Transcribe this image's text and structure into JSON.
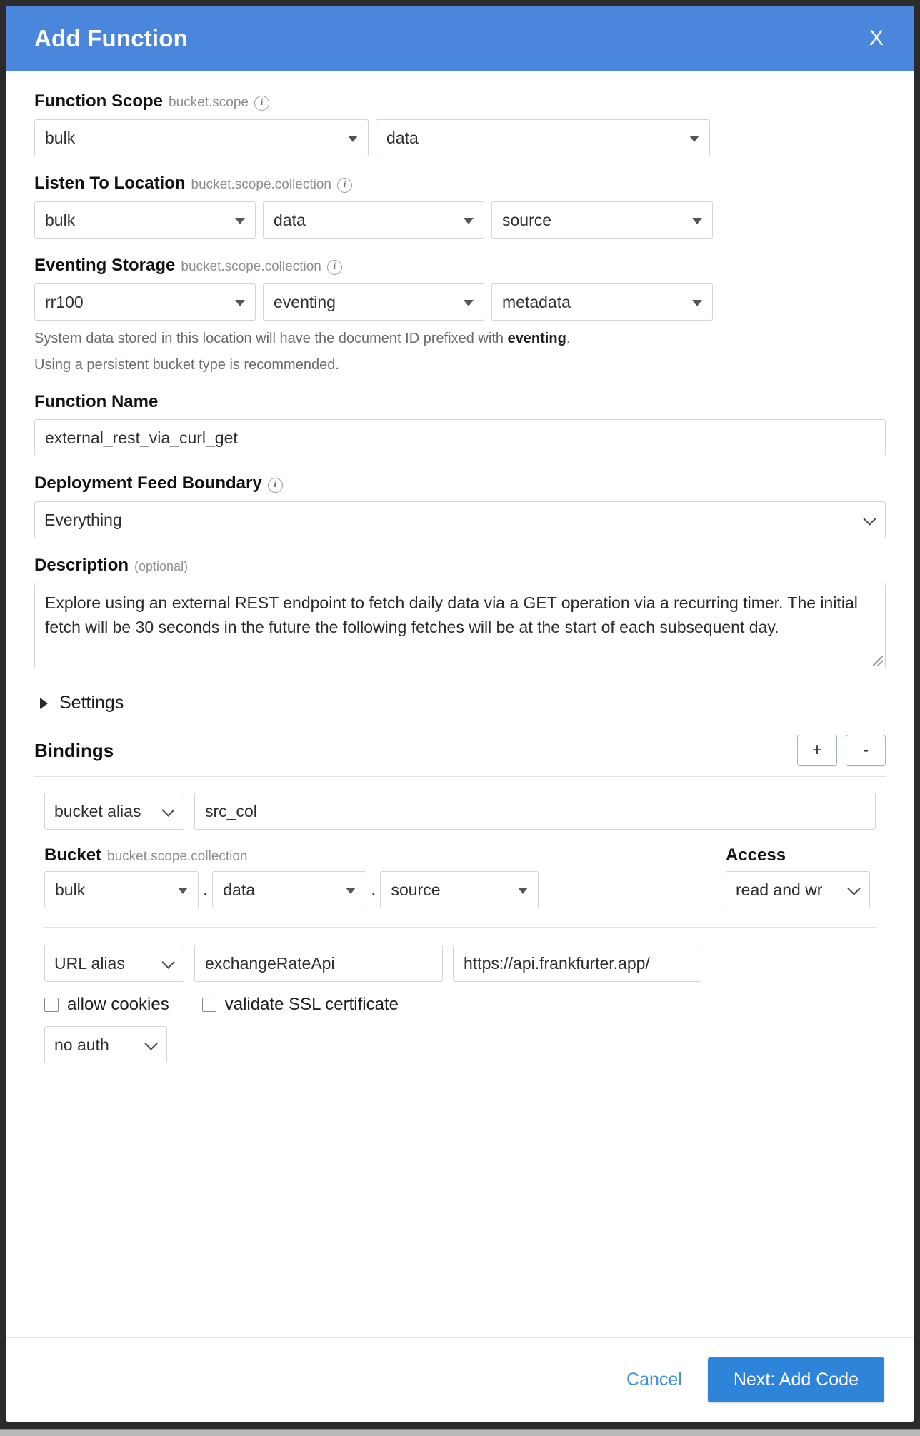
{
  "header": {
    "title": "Add Function",
    "close_label": "X"
  },
  "function_scope": {
    "label": "Function Scope",
    "hint": "bucket.scope",
    "bucket": "bulk",
    "scope": "data"
  },
  "listen_to_location": {
    "label": "Listen To Location",
    "hint": "bucket.scope.collection",
    "bucket": "bulk",
    "scope": "data",
    "collection": "source"
  },
  "eventing_storage": {
    "label": "Eventing Storage",
    "hint": "bucket.scope.collection",
    "bucket": "rr100",
    "scope": "eventing",
    "collection": "metadata",
    "helper_prefix": "System data stored in this location will have the document ID prefixed with ",
    "helper_bold": "eventing",
    "helper_suffix": ".",
    "helper_line2": "Using a persistent bucket type is recommended."
  },
  "function_name": {
    "label": "Function Name",
    "value": "external_rest_via_curl_get"
  },
  "deployment_feed_boundary": {
    "label": "Deployment Feed Boundary",
    "value": "Everything"
  },
  "description": {
    "label": "Description",
    "optional": "(optional)",
    "value": "Explore using an external REST endpoint to fetch daily data via a GET operation via a recurring timer.  The initial fetch will be 30 seconds in the future the following fetches will be at the start of each subsequent day."
  },
  "settings": {
    "label": "Settings"
  },
  "bindings": {
    "title": "Bindings",
    "add_label": "+",
    "remove_label": "-",
    "bucket_binding": {
      "type": "bucket alias",
      "alias": "src_col",
      "bucket_label": "Bucket",
      "bucket_hint": "bucket.scope.collection",
      "access_label": "Access",
      "bucket": "bulk",
      "scope": "data",
      "collection": "source",
      "access": "read and wr",
      "separator": "."
    },
    "url_binding": {
      "type": "URL alias",
      "alias": "exchangeRateApi",
      "url": "https://api.frankfurter.app/",
      "allow_cookies_label": "allow cookies",
      "validate_ssl_label": "validate SSL certificate",
      "auth": "no auth"
    }
  },
  "footer": {
    "cancel_label": "Cancel",
    "next_label": "Next: Add Code"
  },
  "colors": {
    "header_blue": "#4a86dc",
    "primary_blue": "#2d84d8",
    "link_blue": "#3e8fdd",
    "border_gray": "#d4d4d4"
  }
}
